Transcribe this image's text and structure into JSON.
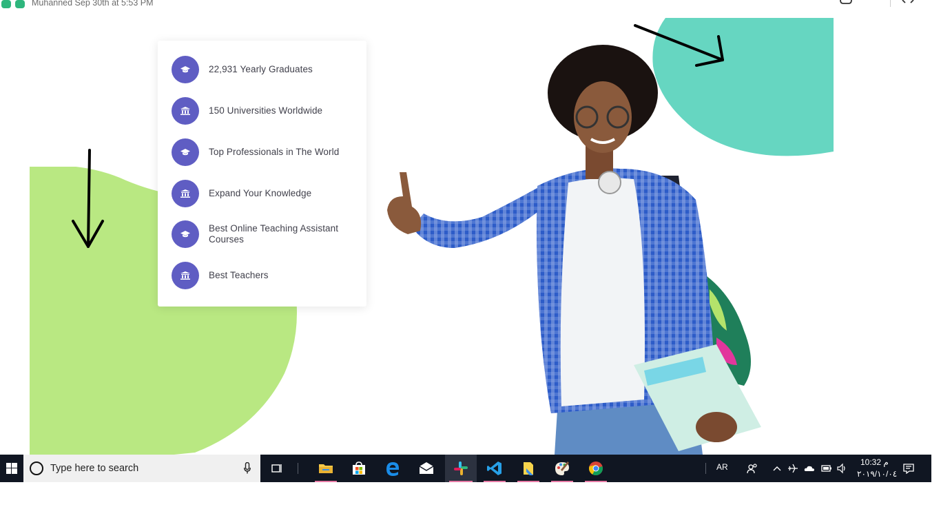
{
  "header": {
    "caption": "Muhanned Sep 30th at 5:53 PM"
  },
  "colors": {
    "green_blob": "#b9e882",
    "teal_blob": "#66d6c1",
    "icon_circle": "#5f5dc3",
    "taskbar": "#101622"
  },
  "features": [
    {
      "icon": "graduation-cap-icon",
      "label": "22,931 Yearly Graduates"
    },
    {
      "icon": "university-icon",
      "label": "150 Universities Worldwide"
    },
    {
      "icon": "graduation-cap-icon",
      "label": "Top Professionals in The World"
    },
    {
      "icon": "university-icon",
      "label": "Expand Your Knowledge"
    },
    {
      "icon": "graduation-cap-icon",
      "label": "Best Online Teaching Assistant Courses"
    },
    {
      "icon": "university-icon",
      "label": "Best Teachers"
    }
  ],
  "taskbar": {
    "search_placeholder": "Type here to search",
    "apps": [
      "file-explorer",
      "microsoft-store",
      "edge",
      "mail",
      "slack",
      "vscode",
      "sticky-explorer",
      "paint",
      "chrome"
    ],
    "language": "AR",
    "time": "10:32 م",
    "date": "٢٠١٩/١٠/٠٤"
  }
}
